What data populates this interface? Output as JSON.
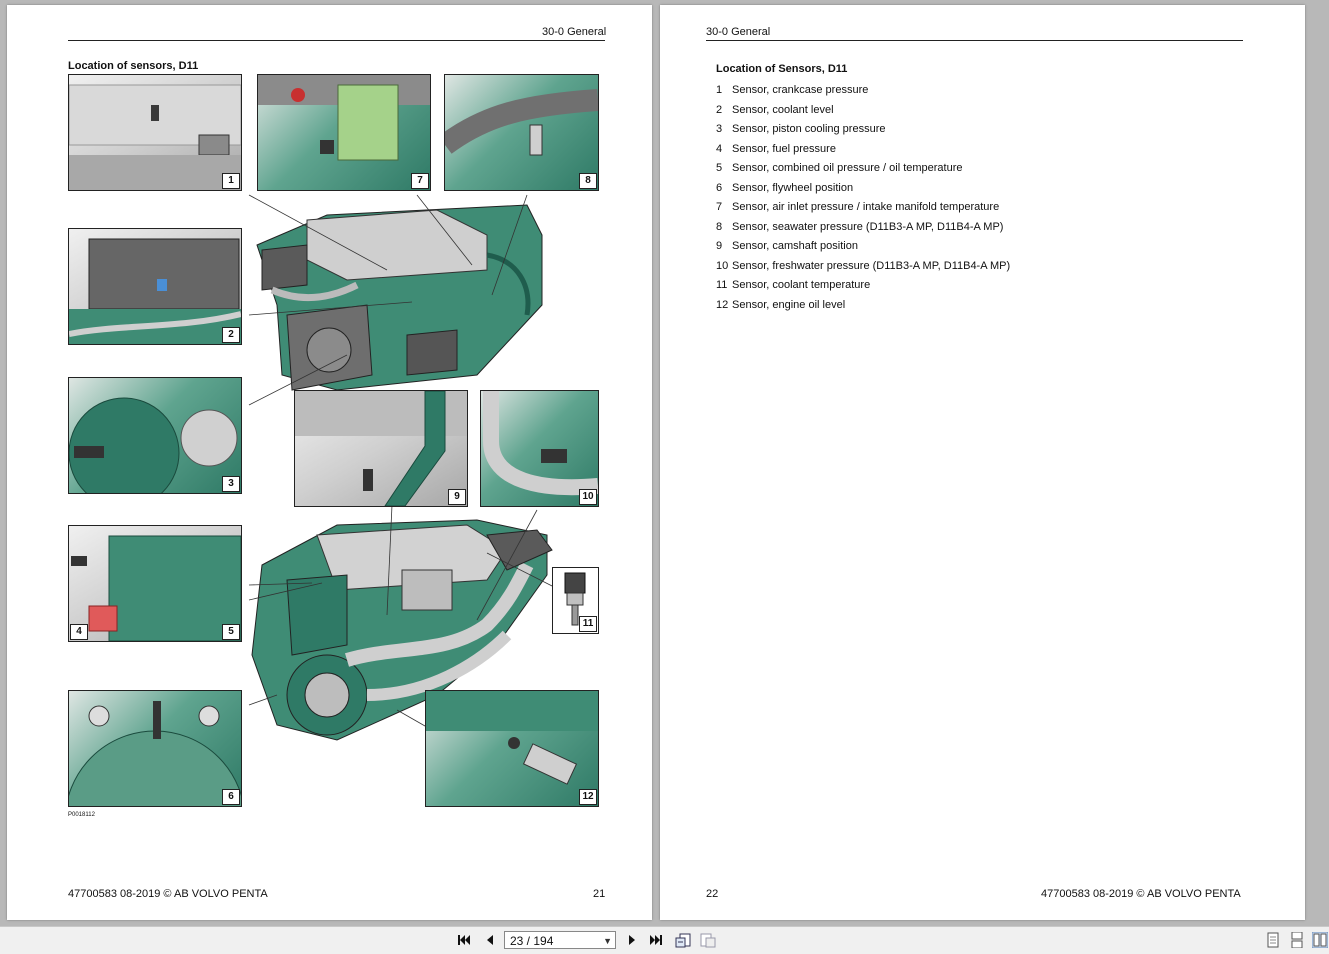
{
  "left_page": {
    "header": "30-0 General",
    "figure_title": "Location of sensors, D11",
    "figure_code": "P0018112",
    "callouts": [
      "1",
      "7",
      "8",
      "2",
      "3",
      "9",
      "10",
      "4",
      "5",
      "11",
      "6",
      "12"
    ],
    "footer_doc": "47700583 08-2019 © AB VOLVO PENTA",
    "page_number": "21"
  },
  "right_page": {
    "header": "30-0 General",
    "list_title": "Location of Sensors, D11",
    "sensors": [
      {
        "num": "1",
        "label": "Sensor, crankcase pressure"
      },
      {
        "num": "2",
        "label": "Sensor, coolant level"
      },
      {
        "num": "3",
        "label": "Sensor, piston cooling pressure"
      },
      {
        "num": "4",
        "label": "Sensor, fuel pressure"
      },
      {
        "num": "5",
        "label": "Sensor, combined oil pressure / oil temperature"
      },
      {
        "num": "6",
        "label": "Sensor, flywheel position"
      },
      {
        "num": "7",
        "label": "Sensor, air inlet pressure / intake manifold temperature"
      },
      {
        "num": "8",
        "label": "Sensor, seawater pressure (D11B3-A MP, D11B4-A MP)"
      },
      {
        "num": "9",
        "label": "Sensor, camshaft position"
      },
      {
        "num": "10",
        "label": "Sensor, freshwater pressure (D11B3-A MP, D11B4-A MP)"
      },
      {
        "num": "11",
        "label": "Sensor, coolant temperature"
      },
      {
        "num": "12",
        "label": "Sensor, engine oil level"
      }
    ],
    "page_number": "22",
    "footer_doc": "47700583 08-2019 © AB VOLVO PENTA"
  },
  "toolbar": {
    "page_indicator": "23 / 194",
    "icons": [
      "first-page-icon",
      "previous-page-icon",
      "next-page-icon",
      "last-page-icon",
      "go-back-icon",
      "go-forward-icon",
      "single-page-view-icon",
      "continuous-view-icon",
      "facing-pages-view-icon"
    ]
  },
  "colors": {
    "engine_green": "#2f7a66",
    "page_background": "#ffffff",
    "viewer_background": "#b8b8b8"
  }
}
